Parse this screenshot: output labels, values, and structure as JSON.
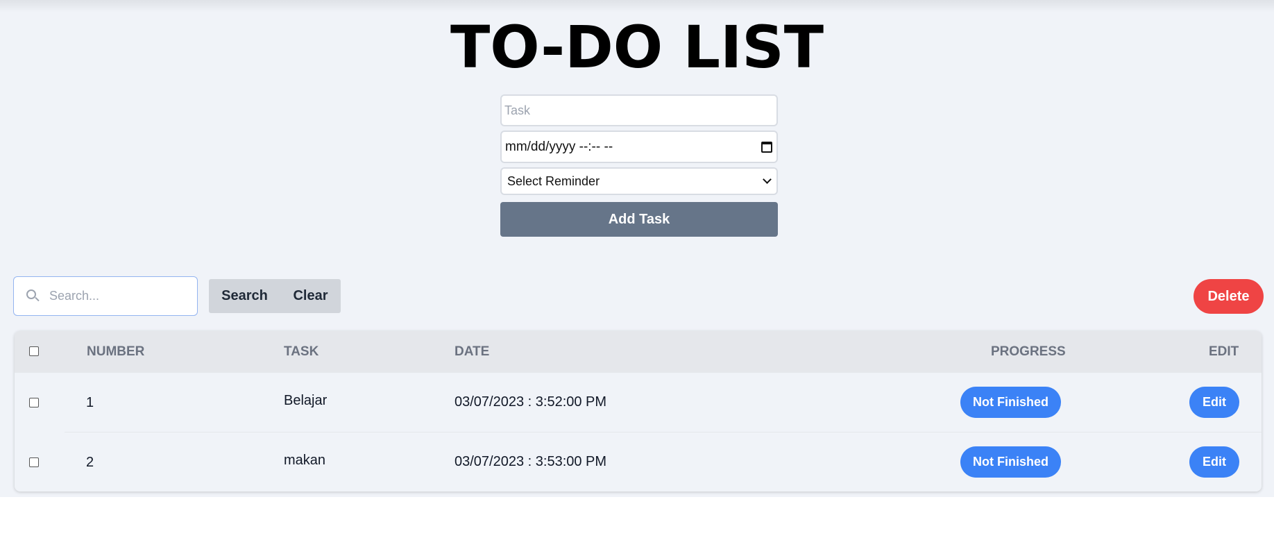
{
  "page": {
    "title": "TO-DO LIST"
  },
  "form": {
    "task_placeholder": "Task",
    "date_value": "mm/dd/yyyy --:-- --",
    "reminder_selected": "Select Reminder",
    "add_label": "Add Task"
  },
  "toolbar": {
    "search_placeholder": "Search...",
    "search_label": "Search",
    "clear_label": "Clear",
    "delete_label": "Delete"
  },
  "table": {
    "headers": {
      "number": "NUMBER",
      "task": "TASK",
      "date": "DATE",
      "progress": "PROGRESS",
      "edit": "EDIT"
    },
    "rows": [
      {
        "number": "1",
        "task": "Belajar",
        "date": "03/07/2023 : 3:52:00 PM",
        "progress": "Not Finished",
        "edit": "Edit"
      },
      {
        "number": "2",
        "task": "makan",
        "date": "03/07/2023 : 3:53:00 PM",
        "progress": "Not Finished",
        "edit": "Edit"
      }
    ]
  },
  "colors": {
    "accent": "#3b82f6",
    "danger": "#ef4444",
    "primary_button": "#667589"
  },
  "icons": {
    "search": "search-icon",
    "calendar": "calendar-icon",
    "dropdown": "chevron-down-icon"
  }
}
